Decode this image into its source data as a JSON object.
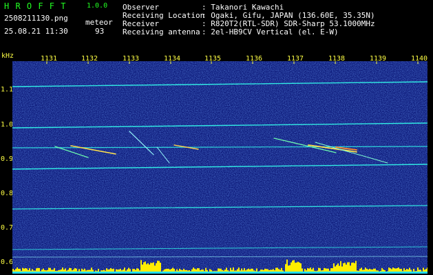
{
  "header": {
    "app_title": "H R O F F T",
    "app_version": "1.0.0",
    "filename": "2508211130.png",
    "datetime": "25.08.21 11:30",
    "detector_label": "meteor",
    "detector_count": "93"
  },
  "info": [
    {
      "label": "Observer",
      "value": ": Takanori Kawachi"
    },
    {
      "label": "Receiving Location",
      "value": ": Ogaki, Gifu, JAPAN (136.60E, 35.35N)"
    },
    {
      "label": "Receiver",
      "value": ": R820T2(RTL-SDR) SDR-Sharp 53.1000MHz"
    },
    {
      "label": "Receiving antenna",
      "value": ": 2el-HB9CV Vertical (el. E-W)"
    }
  ],
  "axes": {
    "y_unit": "kHz",
    "x_ticks": [
      "1131",
      "1132",
      "1133",
      "1134",
      "1135",
      "1136",
      "1137",
      "1138",
      "1139",
      "1140"
    ],
    "y_ticks": [
      "1.1",
      "1.0",
      "0.9",
      "0.8",
      "0.7",
      "0.6"
    ]
  },
  "colors": {
    "background": "#000000",
    "plot_bg": "#0d1a7a",
    "header_text": "#ffffff",
    "tick_text": "#ffff44",
    "title_green": "#22ff22"
  }
}
